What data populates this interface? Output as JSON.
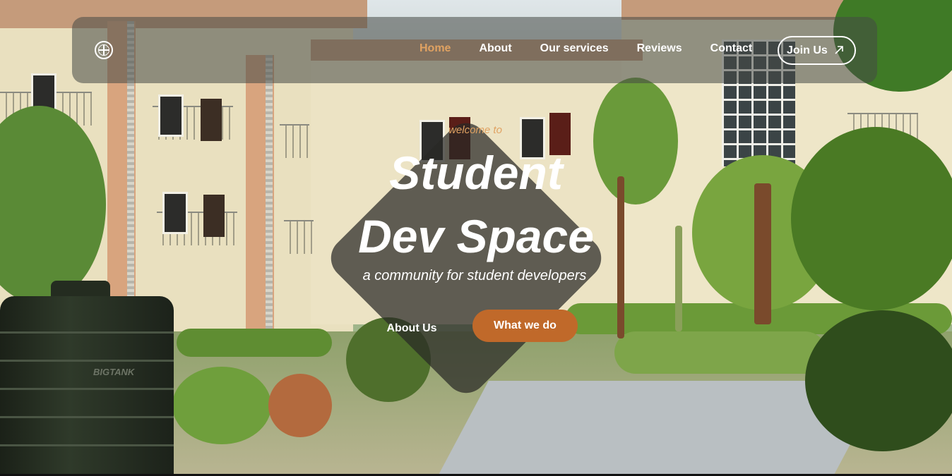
{
  "nav": {
    "logo_icon": "globe-icon",
    "links": [
      {
        "label": "Home",
        "active": true
      },
      {
        "label": "About",
        "active": false
      },
      {
        "label": "Our services",
        "active": false
      },
      {
        "label": "Reviews",
        "active": false
      },
      {
        "label": "Contact",
        "active": false
      }
    ],
    "cta": {
      "label": "Join Us",
      "icon": "arrow-up-right-icon"
    }
  },
  "hero": {
    "welcome": "welcome to",
    "title_line1": "Student",
    "title_line2": "Dev Space",
    "subtitle": "a community for student developers",
    "secondary_button": "About Us",
    "primary_button": "What we do",
    "background": "campus-building-photo"
  },
  "background_text": {
    "tank_label": "BIGTANK"
  },
  "colors": {
    "accent_orange": "#c0692a",
    "active_link": "#e0a262",
    "nav_background": "rgba(70,72,70,0.55)",
    "overlay_dark": "#282826"
  }
}
